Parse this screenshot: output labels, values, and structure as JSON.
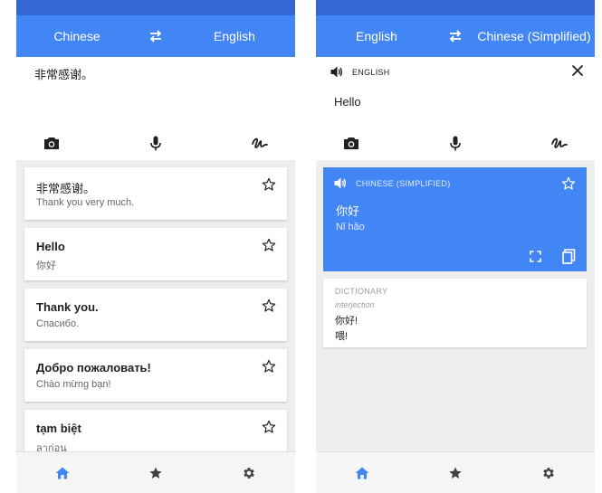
{
  "colors": {
    "primary": "#4285f4",
    "primary_dark": "#3367d6",
    "background": "#eeeeee"
  },
  "left": {
    "header": {
      "source_lang": "Chinese",
      "target_lang": "English"
    },
    "input": {
      "text": "非常感谢。"
    },
    "history": [
      {
        "source": "非常感谢。",
        "target": "Thank you very much."
      },
      {
        "source": "Hello",
        "target": "你好"
      },
      {
        "source": "Thank you.",
        "target": "Спасибо."
      },
      {
        "source": "Добро пожаловать!",
        "target": "Chào mừng bạn!"
      },
      {
        "source": "tạm biệt",
        "target": "ลาก่อน"
      }
    ]
  },
  "right": {
    "header": {
      "source_lang": "English",
      "target_lang": "Chinese (Simplified)"
    },
    "source": {
      "lang_label": "ENGLISH",
      "text": "Hello"
    },
    "result": {
      "lang_label": "CHINESE (SIMPLIFIED)",
      "text": "你好",
      "transliteration": "Nǐ hǎo"
    },
    "dictionary": {
      "title": "DICTIONARY",
      "part_of_speech": "interjection",
      "entries": [
        "你好!",
        "喂!"
      ]
    }
  },
  "icons": {
    "swap": "swap-arrows-icon",
    "camera": "camera-icon",
    "mic": "microphone-icon",
    "handwriting": "handwriting-icon",
    "star": "star-outline-icon",
    "speaker": "speaker-icon",
    "close": "close-icon",
    "fullscreen": "fullscreen-icon",
    "copy": "copy-icon",
    "home": "home-icon",
    "phrasebook": "star-filled-icon",
    "settings": "gear-icon"
  }
}
